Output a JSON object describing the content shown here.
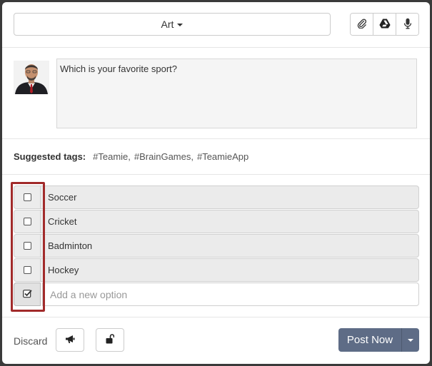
{
  "header": {
    "category": "Art",
    "tools": [
      {
        "icon": "paperclip-icon"
      },
      {
        "icon": "google-drive-icon"
      },
      {
        "icon": "microphone-icon"
      }
    ]
  },
  "composer": {
    "question": "Which is your favorite sport?"
  },
  "tags": {
    "label": "Suggested tags:",
    "items": [
      "#Teamie,",
      "#BrainGames,",
      "#TeamieApp"
    ]
  },
  "poll": {
    "options": [
      "Soccer",
      "Cricket",
      "Badminton",
      "Hockey"
    ],
    "new_option_placeholder": "Add a new option"
  },
  "footer": {
    "discard": "Discard",
    "announce_icon": "megaphone-icon",
    "privacy_icon": "unlock-icon",
    "post_label": "Post Now"
  },
  "colors": {
    "post_button": "#5e6c86",
    "highlight": "#a12a2a"
  }
}
